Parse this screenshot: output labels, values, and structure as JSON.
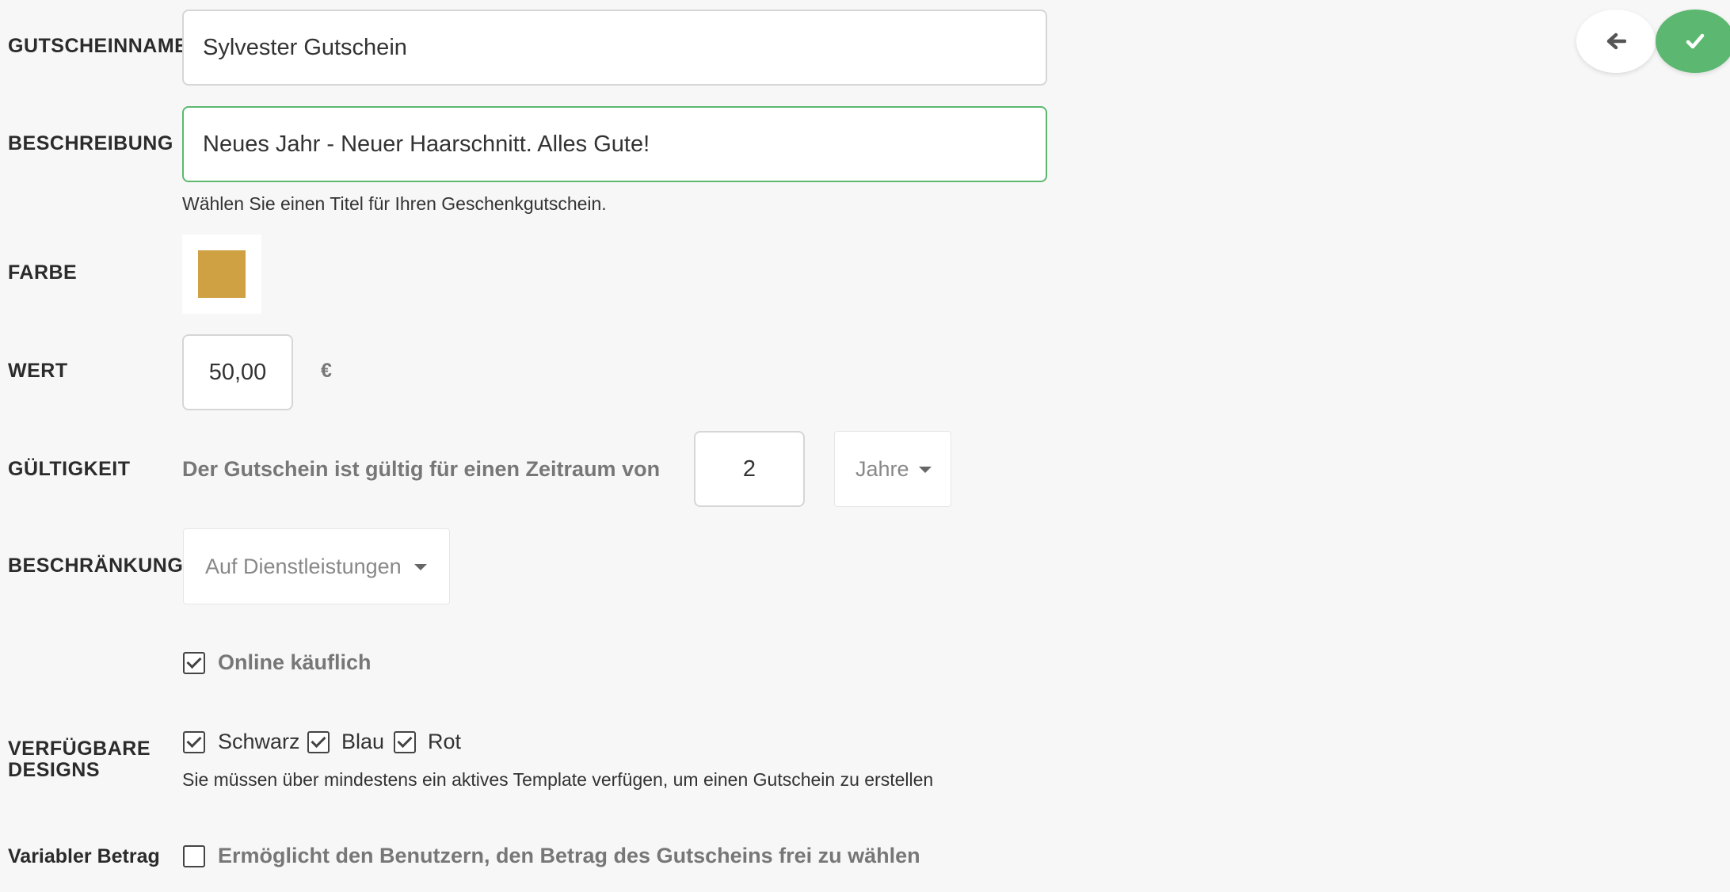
{
  "fields": {
    "name": {
      "label": "GUTSCHEINNAME",
      "value": "Sylvester Gutschein"
    },
    "description": {
      "label": "BESCHREIBUNG",
      "value": "Neues Jahr - Neuer Haarschnitt. Alles Gute!",
      "help": "Wählen Sie einen Titel für Ihren Geschenkgutschein."
    },
    "color": {
      "label": "FARBE",
      "value": "#cfa142"
    },
    "value": {
      "label": "WERT",
      "amount": "50,00",
      "currency": "€"
    },
    "validity": {
      "label": "GÜLTIGKEIT",
      "text": "Der Gutschein ist gültig für einen Zeitraum von",
      "amount": "2",
      "unit": "Jahre"
    },
    "restriction": {
      "label": "BESCHRÄNKUNG",
      "selected": "Auf Dienstleistungen"
    },
    "online": {
      "label": "Online käuflich",
      "checked": true
    },
    "designs": {
      "label_line1": "VERFÜGBARE",
      "label_line2": "DESIGNS",
      "options": [
        {
          "label": "Schwarz",
          "checked": true
        },
        {
          "label": "Blau",
          "checked": true
        },
        {
          "label": "Rot",
          "checked": true
        }
      ],
      "help": "Sie müssen über mindestens ein aktives Template verfügen, um einen Gutschein zu erstellen"
    },
    "variable": {
      "label": "Variabler Betrag",
      "option": "Ermöglicht den Benutzern, den Betrag des Gutscheins frei zu wählen",
      "checked": false
    }
  },
  "actions": {
    "back_icon": "arrow-left-icon",
    "confirm_icon": "check-icon",
    "confirm_color": "#5cb870"
  },
  "colors": {
    "focus_border": "#5cb870"
  }
}
